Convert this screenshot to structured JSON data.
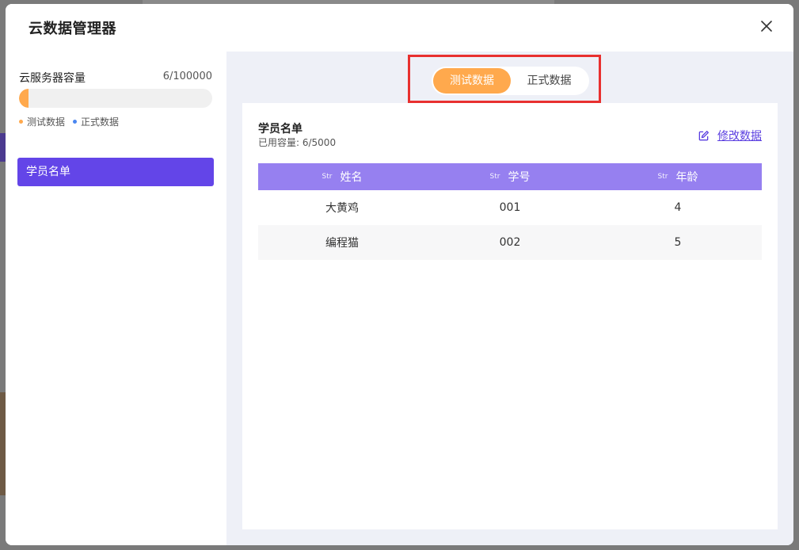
{
  "dialog": {
    "title": "云数据管理器"
  },
  "sidebar": {
    "capacity_label": "云服务器容量",
    "capacity_value": "6/100000",
    "capacity_fraction": 0.05,
    "legend": [
      {
        "label": "测试数据",
        "color": "#ffa94d"
      },
      {
        "label": "正式数据",
        "color": "#4a86f0"
      }
    ],
    "items": [
      {
        "label": "学员名单"
      }
    ]
  },
  "toggle": {
    "active_label": "测试数据",
    "inactive_label": "正式数据"
  },
  "card": {
    "title": "学员名单",
    "subtitle": "已用容量: 6/5000",
    "edit_label": "修改数据"
  },
  "table": {
    "columns": [
      {
        "type": "Str",
        "label": "姓名"
      },
      {
        "type": "Str",
        "label": "学号"
      },
      {
        "type": "Str",
        "label": "年龄"
      }
    ],
    "rows": [
      [
        "大黄鸡",
        "001",
        "4"
      ],
      [
        "编程猫",
        "002",
        "5"
      ]
    ]
  },
  "colors": {
    "accent_purple": "#6345e8",
    "header_purple": "#9680f0",
    "accent_orange": "#ffa94d",
    "highlight_red": "#e8302f"
  },
  "icons": {
    "close": "close-icon",
    "edit": "edit-icon"
  }
}
